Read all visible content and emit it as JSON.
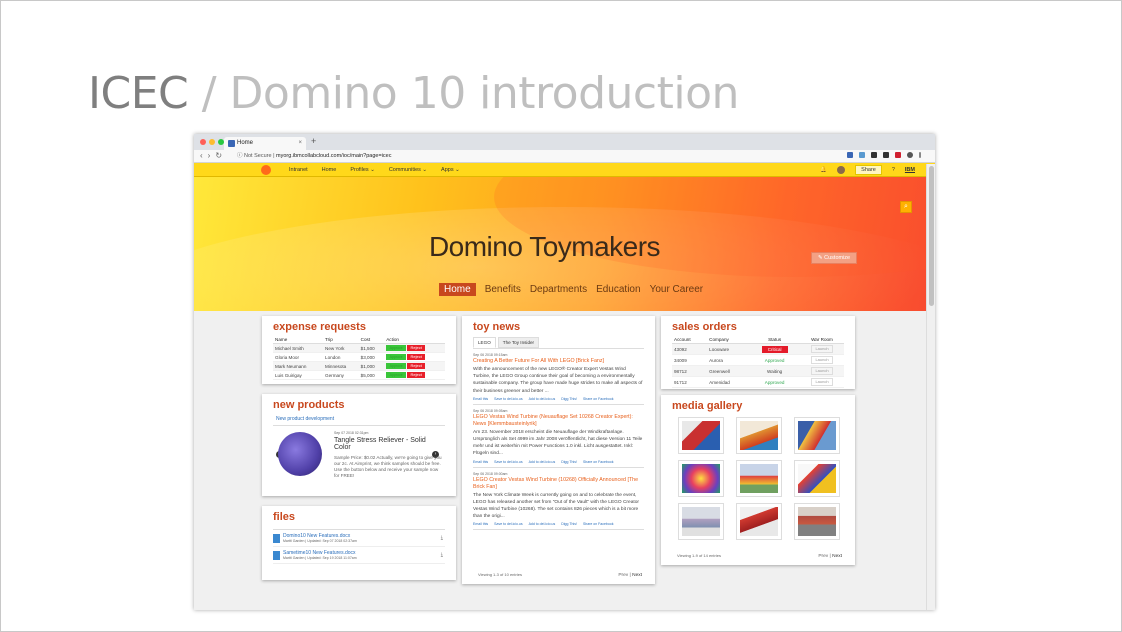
{
  "slide": {
    "title_main": "ICEC",
    "title_sep": " / ",
    "title_sub": "Domino 10 introduction"
  },
  "browser": {
    "tab_title": "Home",
    "url_prefix": "Not Secure",
    "url": "myorg.ibmcollabcloud.com/ioc/main?page=icec",
    "dot_colors": [
      "#ff5f57",
      "#febc2e",
      "#28c840"
    ]
  },
  "appnav": {
    "items": [
      "Intranet",
      "Home",
      "Profiles ⌄",
      "Communities ⌄",
      "Apps ⌄"
    ],
    "share": "Share",
    "brand": "IBM"
  },
  "hero": {
    "title": "Domino Toymakers",
    "menu": [
      "Home",
      "Benefits",
      "Departments",
      "Education",
      "Your Career"
    ],
    "customize": "✎ Customize"
  },
  "expense": {
    "title": "expense requests",
    "headers": [
      "Name",
      "Trip",
      "Cost",
      "Action"
    ],
    "rows": [
      [
        "Michael Smith",
        "New York",
        "$1,500"
      ],
      [
        "Gloria Moor",
        "London",
        "$3,000"
      ],
      [
        "Mark Neumann",
        "Minnesota",
        "$1,000"
      ],
      [
        "Luis Guirigay",
        "Germany",
        "$5,000"
      ]
    ],
    "approve": "Approve",
    "reject": "Reject"
  },
  "products": {
    "title": "new products",
    "header": "New product development",
    "date": "Sep 07 2018 02:31pm",
    "name": "Tangle Stress Reliever - Solid Color",
    "desc": "Sample Price: $0.02 Actually, we're going to give you our 2c. At Aimprint, we think samples should be free. Use the button below and receive your sample now for FREE!"
  },
  "files": {
    "title": "files",
    "items": [
      {
        "name": "Domino10 New Features.docx",
        "author": "Martti Garden",
        "meta": "Updated: Sep 07 2018 02:37am"
      },
      {
        "name": "Sametime10 New Features.docx",
        "author": "Martti Garden",
        "meta": "Updated: Sep 19 2018 11:07am"
      }
    ]
  },
  "news": {
    "title": "toy news",
    "tabs": [
      "LEGO",
      "The Toy Insider"
    ],
    "articles": [
      {
        "date": "Sep 06 2018 09:15am",
        "title": "Creating A Better Future For All With LEGO [Brick Fanz]",
        "body": "With the announcement of the new LEGO® Creator Expert Vestas Wind Turbine, the LEGO Group continue their goal of becoming a environmentally sustainable company. The group have made huge strides to make all aspects of their business greener and better ..."
      },
      {
        "date": "Sep 06 2018 09:05am",
        "title": "LEGO Vestas Wind Turbine (Neuauflage Set 10268 Creator Expert): News [Klemmbausteinlyrik]",
        "body": "Am 23. November 2018 erscheint die Neuauflage der Windkraftanlage. Ursprünglich als Set 4999 im Jahr 2008 veröffentlicht, hat diese Version 11 Teile mehr und ist weiterhin mit Power Functions 1.0 inkl. Licht ausgestattet. Inkl: Flügeln sind..."
      },
      {
        "date": "Sep 06 2018 09:00am",
        "title": "LEGO Creator Vestas Wind Turbine (10268) Officially Announced [The Brick Fan]",
        "body": "The New York Climate Week is currently going on and to celebrate the event, LEGO has released another set from \"Out of the Vault\" with the LEGO Creator Vestas Wind Turbine (10268). The set contains 826 pieces which is a bit more than the origi..."
      }
    ],
    "links": [
      "Email this",
      "Save to del.icio.us",
      "Add to del.icio.us",
      "Digg This!",
      "Share on Facebook"
    ],
    "viewing": "Viewing 1-3 of 10 entries",
    "prev": "Prev",
    "next": "Next"
  },
  "sales": {
    "title": "sales orders",
    "headers": [
      "Account",
      "Company",
      "Status",
      "War Room"
    ],
    "rows": [
      [
        "43092",
        "Looxware",
        "Critical"
      ],
      [
        "34009",
        "Aurora",
        "Approved"
      ],
      [
        "98712",
        "Greenwell",
        "Waiting"
      ],
      [
        "91712",
        "Amenidad",
        "Approved"
      ]
    ],
    "launch": "Launch"
  },
  "gallery": {
    "title": "media gallery",
    "viewing": "Viewing 1-9 of 14 entries",
    "prev": "Prev",
    "next": "Next",
    "thumbs": [
      "#c93030",
      "#e7c9a0",
      "#3a5fa8",
      "#d24aa0",
      "#9ab0d0",
      "#e84030",
      "#c0c0c8",
      "#d03a30",
      "#b04a40"
    ]
  }
}
